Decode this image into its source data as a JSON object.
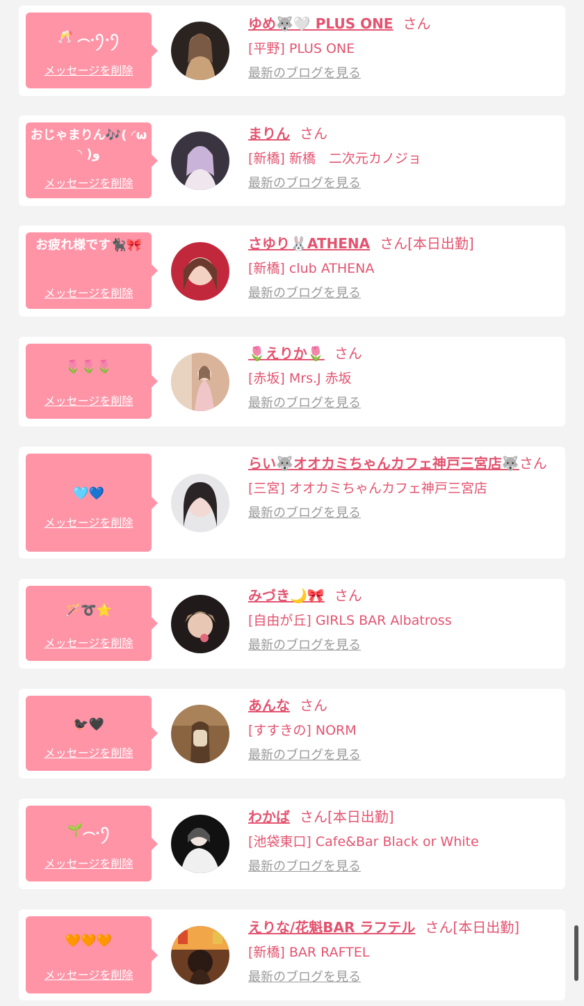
{
  "cards": [
    {
      "message": "🥂 ︵.ꪆ.ꪆ ",
      "delete_label": "メッセージを削除",
      "name": "ゆめ🐺🤍 PLUS ONE",
      "san": "さん",
      "status": "",
      "shop": "[平野] PLUS ONE",
      "blog_label": "最新のブログを見る",
      "avatar_colors": [
        "#2b2320",
        "#c9a27a",
        "#7a5a44"
      ]
    },
    {
      "message": "おじゃまりん🎶( ◜ω◝ )و",
      "delete_label": "メッセージを削除",
      "name": "まりん",
      "san": "さん",
      "status": "",
      "shop": "[新橋] 新橋　二次元カノジョ",
      "blog_label": "最新のブログを見る",
      "avatar_colors": [
        "#3a3340",
        "#c9b3d8",
        "#f0e6ee"
      ]
    },
    {
      "message": "お疲れ様です🐈‍⬛🎀",
      "delete_label": "メッセージを削除",
      "name": "さゆり🐰ATHENA",
      "san": "さん",
      "status": "[本日出勤]",
      "shop": "[新橋] club ATHENA",
      "blog_label": "最新のブログを見る",
      "avatar_colors": [
        "#c2283c",
        "#f3d2c4",
        "#6b3a2e"
      ]
    },
    {
      "message": "🌷🌷🌷",
      "delete_label": "メッセージを削除",
      "name": "🌷えりか🌷",
      "san": "さん",
      "status": "",
      "shop": "[赤坂] Mrs.J 赤坂",
      "blog_label": "最新のブログを見る",
      "avatar_colors": [
        "#d9b39a",
        "#f1c6c9",
        "#8a6a55"
      ]
    },
    {
      "message": "🩵💙",
      "delete_label": "メッセージを削除",
      "name": "らい🐺オオカミちゃんカフェ神戸三宮店🐺",
      "san": "さん",
      "status": "",
      "shop": "[三宮] オオカミちゃんカフェ神戸三宮店",
      "blog_label": "最新のブログを見る",
      "avatar_colors": [
        "#e7e7e9",
        "#2a2426",
        "#f2d9d3"
      ]
    },
    {
      "message": "🪄➰⭐️",
      "delete_label": "メッセージを削除",
      "name": "みづき🌙🎀",
      "san": "さん",
      "status": "",
      "shop": "[自由が丘] GIRLS BAR Albatross",
      "blog_label": "最新のブログを見る",
      "avatar_colors": [
        "#201a1a",
        "#e8c8b4",
        "#b0926f"
      ]
    },
    {
      "message": "🐦‍⬛🖤",
      "delete_label": "メッセージを削除",
      "name": "あんな",
      "san": "さん",
      "status": "",
      "shop": "[すすきの] NORM",
      "blog_label": "最新のブログを見る",
      "avatar_colors": [
        "#8a6440",
        "#e6d7bd",
        "#5a3d28"
      ]
    },
    {
      "message": "🌱︵.ꪆ",
      "delete_label": "メッセージを削除",
      "name": "わかば",
      "san": "さん",
      "status": "[本日出勤]",
      "shop": "[池袋東口] Cafe&Bar Black or White",
      "blog_label": "最新のブログを見る",
      "avatar_colors": [
        "#111111",
        "#f0f0f0",
        "#555555"
      ]
    },
    {
      "message": "🧡🧡🧡",
      "delete_label": "メッセージを削除",
      "name": "えりな/花魁BAR ラフテル",
      "san": "さん",
      "status": "[本日出勤]",
      "shop": "[新橋] BAR RAFTEL",
      "blog_label": "最新のブログを見る",
      "avatar_colors": [
        "#6b3d22",
        "#f2a64a",
        "#2b1a13"
      ]
    }
  ]
}
